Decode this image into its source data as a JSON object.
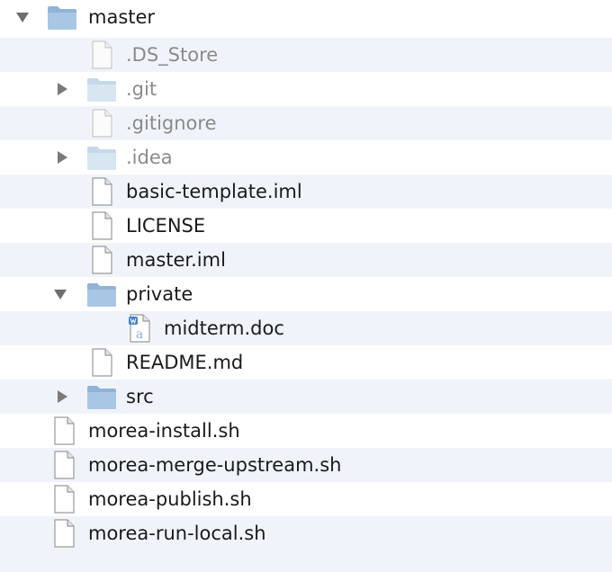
{
  "tree": {
    "items": [
      {
        "name": "master",
        "kind": "folder",
        "expanded": true,
        "dim": false
      },
      {
        "name": ".DS_Store",
        "kind": "file",
        "dim": true
      },
      {
        "name": ".git",
        "kind": "folder",
        "expanded": false,
        "dim": true
      },
      {
        "name": ".gitignore",
        "kind": "file",
        "dim": true
      },
      {
        "name": ".idea",
        "kind": "folder",
        "expanded": false,
        "dim": true
      },
      {
        "name": "basic-template.iml",
        "kind": "file",
        "dim": false
      },
      {
        "name": "LICENSE",
        "kind": "file",
        "dim": false
      },
      {
        "name": "master.iml",
        "kind": "file",
        "dim": false
      },
      {
        "name": "private",
        "kind": "folder",
        "expanded": true,
        "dim": false
      },
      {
        "name": "midterm.doc",
        "kind": "doc",
        "dim": false
      },
      {
        "name": "README.md",
        "kind": "file",
        "dim": false
      },
      {
        "name": "src",
        "kind": "folder",
        "expanded": false,
        "dim": false
      },
      {
        "name": "morea-install.sh",
        "kind": "file",
        "dim": false
      },
      {
        "name": "morea-merge-upstream.sh",
        "kind": "file",
        "dim": false
      },
      {
        "name": "morea-publish.sh",
        "kind": "file",
        "dim": false
      },
      {
        "name": "morea-run-local.sh",
        "kind": "file",
        "dim": false
      }
    ]
  },
  "icons": {
    "expanded": "disclosure-triangle-down-icon",
    "collapsed": "disclosure-triangle-right-icon",
    "folder": "folder-icon",
    "file": "file-icon",
    "doc": "word-document-icon"
  },
  "colors": {
    "row_alt": "#f0f4fa",
    "text": "#1a1a1a",
    "text_dim": "#8a8a8a",
    "folder": "#8fb4d6",
    "folder_dim": "#c5d9ea"
  }
}
